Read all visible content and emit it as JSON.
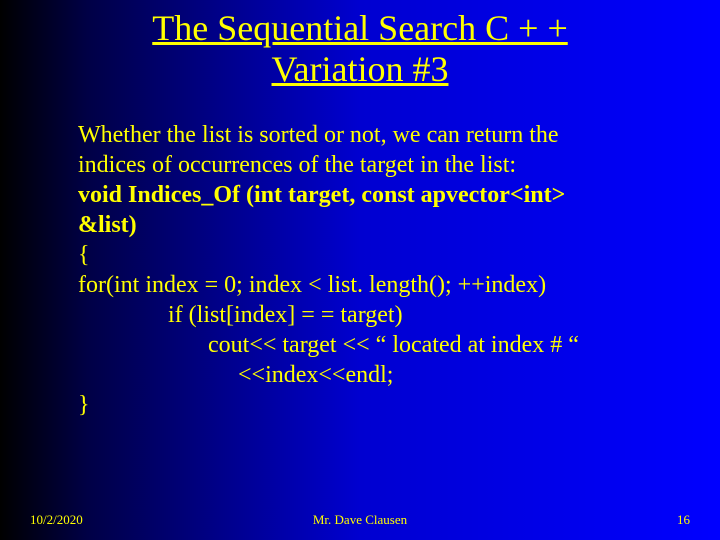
{
  "title_line1": "The Sequential Search C + +",
  "title_line2": "Variation #3",
  "body": {
    "l1": "Whether  the list is sorted or not, we can return the",
    "l2": "indices of occurrences of the target in the list:",
    "l3": "void Indices_Of (int target, const apvector<int>",
    "l4": "&list)",
    "l5": "{",
    "l6": "for(int index = 0; index < list. length(); ++index)",
    "l7": "if (list[index] = = target)",
    "l8": "cout<< target << “ located at index #  “",
    "l9": "<<index<<endl;",
    "l10": "}"
  },
  "footer": {
    "date": "10/2/2020",
    "author": "Mr. Dave Clausen",
    "page": "16"
  }
}
